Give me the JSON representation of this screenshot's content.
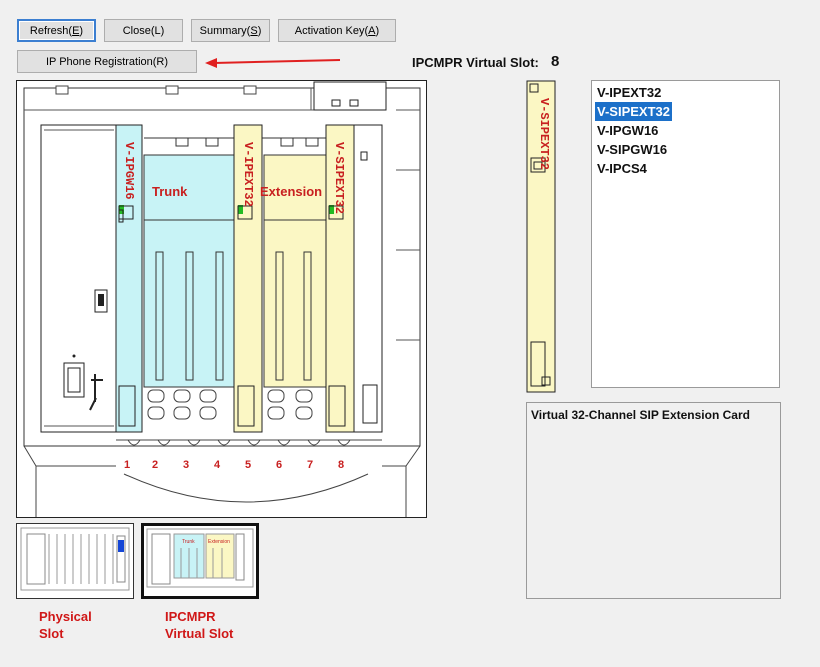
{
  "toolbar": {
    "refresh": {
      "label": "Refresh(",
      "key": "E",
      "end": ")"
    },
    "close": {
      "label": "Close(L)"
    },
    "summary": {
      "label": "Summary(",
      "key": "S",
      "end": ")"
    },
    "activation": {
      "label": "Activation Key(",
      "key": "A",
      "end": ")"
    },
    "ip_phone": {
      "label": "IP Phone Registration(R)"
    }
  },
  "virtual_slot": {
    "label": "IPCMPR Virtual Slot:",
    "value": "8"
  },
  "diagram": {
    "cards": [
      "V-IPGW16",
      "V-IPEXT32",
      "V-SIPEXT32"
    ],
    "zones": [
      "Trunk",
      "Extension"
    ],
    "slot_numbers": [
      "1",
      "2",
      "3",
      "4",
      "5",
      "6",
      "7",
      "8"
    ]
  },
  "preview_card": {
    "label": "V-SIPEXT32"
  },
  "card_list": {
    "items": [
      "V-IPEXT32",
      "V-SIPEXT32",
      "V-IPGW16",
      "V-SIPGW16",
      "V-IPCS4"
    ],
    "selected_index": 1
  },
  "description": "Virtual 32-Channel SIP Extension Card",
  "views": {
    "physical": {
      "line1": "Physical",
      "line2": "Slot"
    },
    "virtual": {
      "line1": "IPCMPR",
      "line2": "Virtual Slot"
    },
    "thumb_trunk": "Trunk",
    "thumb_extension": "Extension"
  },
  "colors": {
    "trunk": "#c8f3f6",
    "extension": "#fbf7c4",
    "selection": "#1c70c9",
    "caption": "#d01717"
  }
}
